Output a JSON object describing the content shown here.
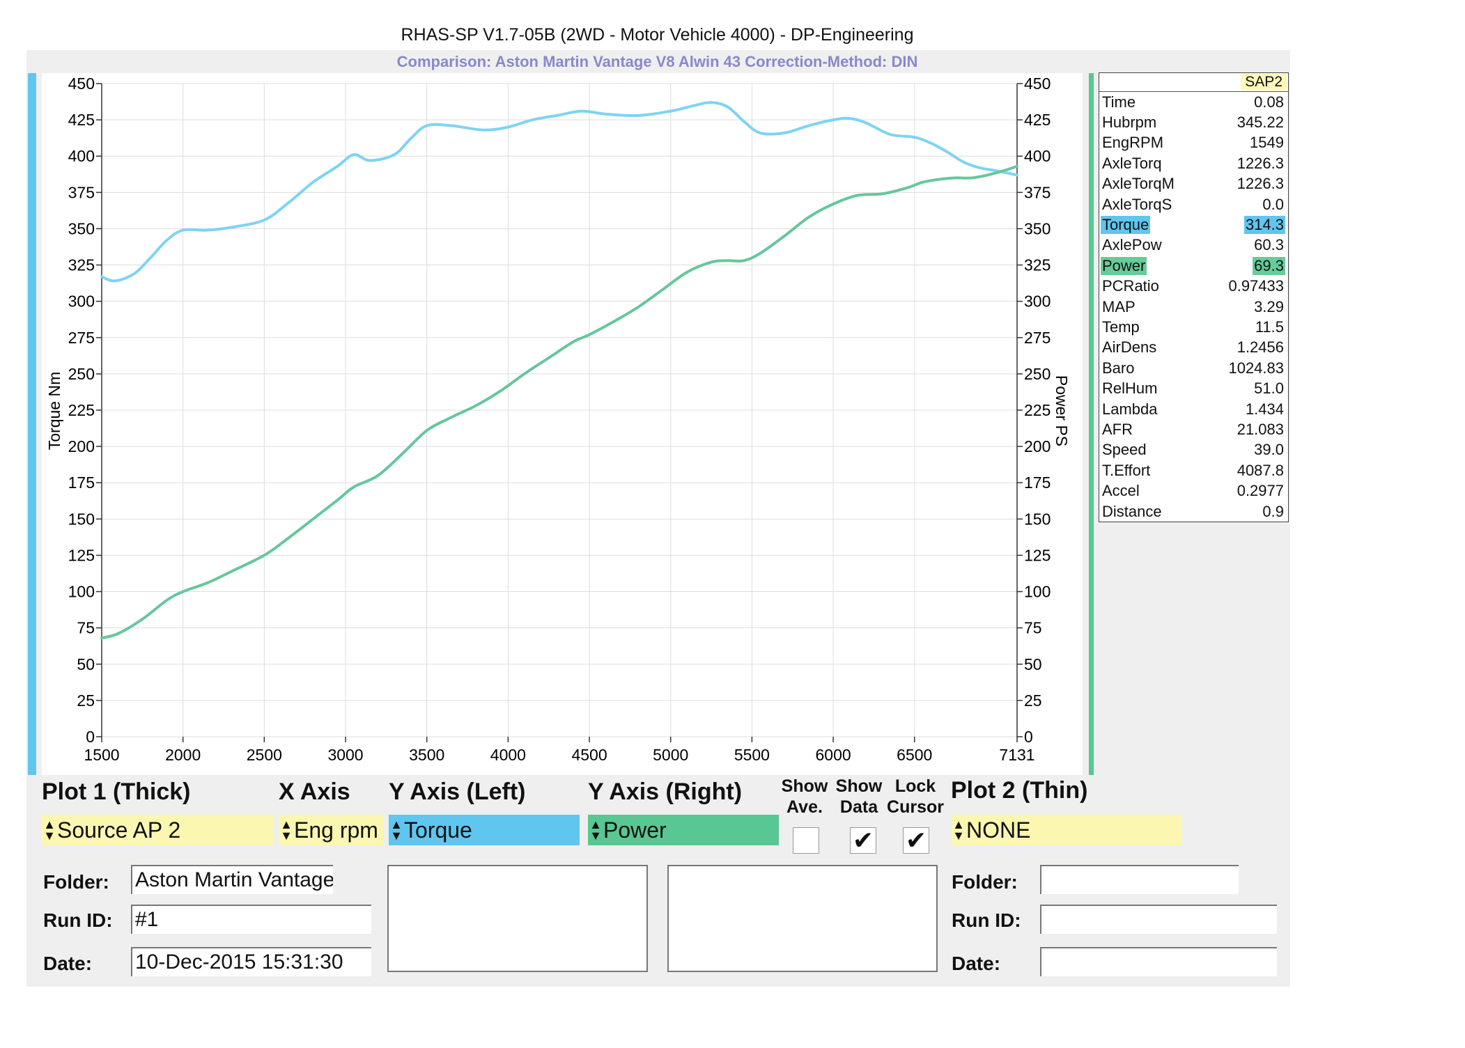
{
  "header": {
    "title": "RHAS-SP V1.7-05B  (2WD - Motor Vehicle 4000) - DP-Engineering",
    "subtitle": "Comparison: Aston Martin Vantage V8 Alwin 43    Correction-Method: DIN"
  },
  "colors": {
    "torque": "#7fd3f3",
    "power": "#66c79c",
    "torque_bar": "#5fc6ef",
    "power_bar": "#59c793",
    "yellow": "#fbf7b0"
  },
  "chart_data": {
    "type": "line",
    "xlabel": "",
    "ylabel_left": "Torque Nm",
    "ylabel_right": "Power PS",
    "xlim": [
      1500,
      7131
    ],
    "ylim": [
      0,
      450
    ],
    "x_ticks": [
      1500,
      2000,
      2500,
      3000,
      3500,
      4000,
      4500,
      5000,
      5500,
      6000,
      6500,
      7131
    ],
    "y_ticks": [
      0,
      25,
      50,
      75,
      100,
      125,
      150,
      175,
      200,
      225,
      250,
      275,
      300,
      325,
      350,
      375,
      400,
      425,
      450
    ],
    "grid": true,
    "series": [
      {
        "name": "Torque",
        "x": [
          1500,
          1580,
          1700,
          1800,
          1900,
          2000,
          2150,
          2300,
          2500,
          2650,
          2800,
          2950,
          3050,
          3150,
          3300,
          3400,
          3500,
          3650,
          3850,
          4000,
          4150,
          4300,
          4450,
          4600,
          4800,
          5000,
          5150,
          5250,
          5350,
          5450,
          5550,
          5700,
          5850,
          6000,
          6100,
          6200,
          6350,
          6500,
          6600,
          6700,
          6800,
          6900,
          7000,
          7131
        ],
        "y": [
          317,
          314,
          319,
          330,
          342,
          349,
          349,
          351,
          356,
          368,
          382,
          393,
          401,
          397,
          401,
          412,
          421,
          421,
          418,
          420,
          425,
          428,
          431,
          429,
          428,
          431,
          435,
          437,
          434,
          424,
          416,
          416,
          421,
          425,
          426,
          423,
          415,
          413,
          409,
          403,
          396,
          392,
          390,
          387
        ]
      },
      {
        "name": "Power",
        "x": [
          1500,
          1600,
          1750,
          1900,
          2000,
          2150,
          2300,
          2500,
          2650,
          2800,
          2950,
          3050,
          3200,
          3350,
          3500,
          3650,
          3800,
          3950,
          4100,
          4250,
          4400,
          4500,
          4650,
          4800,
          4950,
          5100,
          5250,
          5350,
          5450,
          5550,
          5700,
          5850,
          6000,
          6150,
          6300,
          6450,
          6550,
          6650,
          6750,
          6850,
          6950,
          7050,
          7131
        ],
        "y": [
          68,
          71,
          81,
          94,
          100,
          106,
          114,
          125,
          137,
          150,
          163,
          172,
          180,
          195,
          211,
          220,
          228,
          238,
          250,
          261,
          272,
          277,
          286,
          296,
          308,
          320,
          327,
          328,
          328,
          333,
          345,
          358,
          367,
          373,
          374,
          378,
          382,
          384,
          385,
          385,
          387,
          390,
          393
        ]
      }
    ]
  },
  "readout": {
    "head": "SAP2",
    "rows": [
      {
        "label": "Time",
        "value": "0.08"
      },
      {
        "label": "Hubrpm",
        "value": "345.22"
      },
      {
        "label": "EngRPM",
        "value": "1549"
      },
      {
        "label": "AxleTorq",
        "value": "1226.3"
      },
      {
        "label": "AxleTorqM",
        "value": "1226.3"
      },
      {
        "label": "AxleTorqS",
        "value": "0.0"
      },
      {
        "label": "Torque",
        "value": "314.3",
        "highlight": "torque"
      },
      {
        "label": "AxlePow",
        "value": "60.3"
      },
      {
        "label": "Power",
        "value": "69.3",
        "highlight": "power"
      },
      {
        "label": "PCRatio",
        "value": "0.97433"
      },
      {
        "label": "MAP",
        "value": "3.29"
      },
      {
        "label": "Temp",
        "value": "11.5"
      },
      {
        "label": "AirDens",
        "value": "1.2456"
      },
      {
        "label": "Baro",
        "value": "1024.83"
      },
      {
        "label": "RelHum",
        "value": "51.0"
      },
      {
        "label": "Lambda",
        "value": "1.434"
      },
      {
        "label": "AFR",
        "value": "21.083"
      },
      {
        "label": "Speed",
        "value": "39.0"
      },
      {
        "label": "T.Effort",
        "value": "4087.8"
      },
      {
        "label": "Accel",
        "value": "0.2977"
      },
      {
        "label": "Distance",
        "value": "0.9"
      }
    ]
  },
  "controls": {
    "plot1_label": "Plot 1 (Thick)",
    "plot1_value": "Source AP 2",
    "xaxis_label": "X Axis",
    "xaxis_value": "Eng rpm",
    "yleft_label": "Y Axis (Left)",
    "yleft_value": "Torque",
    "yright_label": "Y Axis (Right)",
    "yright_value": "Power",
    "show_ave_label": [
      "Show",
      "Ave."
    ],
    "show_data_label": [
      "Show",
      "Data"
    ],
    "lock_cursor_label": [
      "Lock",
      "Cursor"
    ],
    "show_ave": false,
    "show_data": true,
    "lock_cursor": true,
    "plot2_label": "Plot 2 (Thin)",
    "plot2_value": "NONE",
    "check_glyph": "✔",
    "spin_glyph_up": "▲",
    "spin_glyph_down": "▼"
  },
  "run_info_left": {
    "folder_label": "Folder:",
    "folder_value": "Aston Martin Vantage",
    "runid_label": "Run ID:",
    "runid_value": "#1",
    "date_label": "Date:",
    "date_value": "10-Dec-2015  15:31:30"
  },
  "run_info_right": {
    "folder_label": "Folder:",
    "folder_value": "",
    "runid_label": "Run ID:",
    "runid_value": "",
    "date_label": "Date:",
    "date_value": ""
  }
}
